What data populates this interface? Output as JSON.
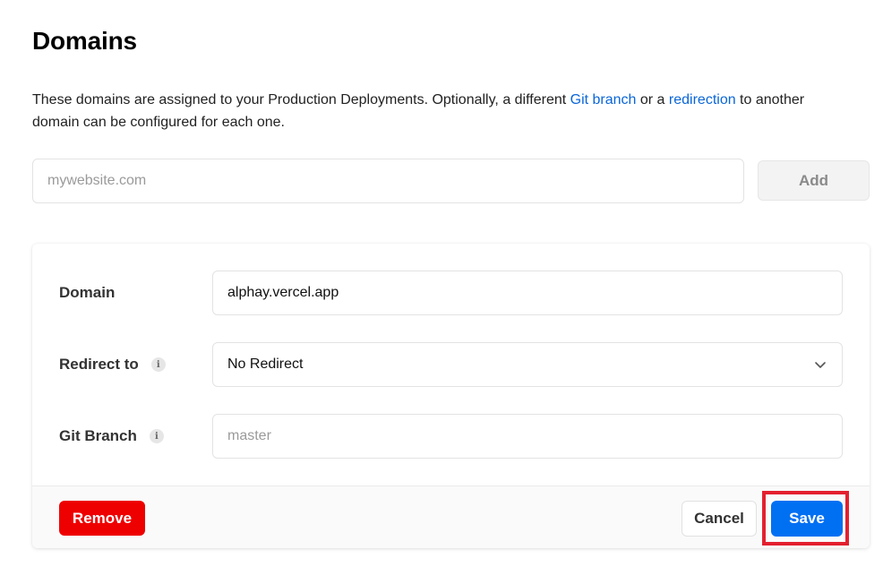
{
  "page": {
    "title": "Domains",
    "description": {
      "part1": "These domains are assigned to your Production Deployments. Optionally, a different ",
      "link1": "Git branch",
      "part2": " or a ",
      "link2": "redirection",
      "part3": " to another domain can be configured for each one."
    }
  },
  "add_domain": {
    "placeholder": "mywebsite.com",
    "value": "",
    "button_label": "Add"
  },
  "domain_card": {
    "domain": {
      "label": "Domain",
      "value": "alphay.vercel.app"
    },
    "redirect": {
      "label": "Redirect to",
      "info_icon": "info-icon",
      "selected": "No Redirect",
      "chevron_icon": "chevron-down-icon"
    },
    "git_branch": {
      "label": "Git Branch",
      "info_icon": "info-icon",
      "placeholder": "master",
      "value": ""
    },
    "footer": {
      "remove_label": "Remove",
      "cancel_label": "Cancel",
      "save_label": "Save"
    }
  },
  "colors": {
    "link": "#0a66d8",
    "danger": "#ee0000",
    "primary": "#0070f3",
    "highlight": "#e3202f"
  }
}
